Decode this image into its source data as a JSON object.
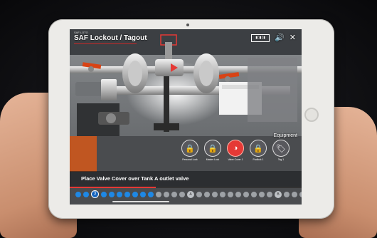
{
  "app": {
    "logo_text": "SAF LOTO",
    "title": "SAF Lockout / Tagout",
    "instruction": "Place Valve Cover over Tank A outlet valve",
    "equipment_label": "Equipment"
  },
  "hud_icons": [
    {
      "name": "qr-code-icon",
      "glyph": "▮▯▮▯▮"
    },
    {
      "name": "speaker-icon",
      "glyph": "🔊"
    },
    {
      "name": "close-icon",
      "glyph": "✕"
    }
  ],
  "equipment": [
    {
      "label": "Personal Lock",
      "icon": "lock-icon",
      "glyph": "🔒",
      "active": false
    },
    {
      "label": "Master Lock",
      "icon": "lock-icon",
      "glyph": "🔒",
      "active": false
    },
    {
      "label": "Valve Cover 1",
      "icon": "valve-cover-icon",
      "glyph": "◑",
      "active": true
    },
    {
      "label": "Padlock 1",
      "icon": "padlock-icon",
      "glyph": "🔒",
      "active": false
    },
    {
      "label": "Tag 1",
      "icon": "tag-icon",
      "glyph": "🏷",
      "active": false
    }
  ],
  "steps": {
    "completed": 2,
    "current_label": "3",
    "total": 30,
    "markers": [
      {
        "index": 14,
        "label": "A"
      },
      {
        "index": 25,
        "label": "B"
      }
    ]
  },
  "progress": 0.37,
  "colors": {
    "accent": "#e53935",
    "step_done": "#1e88e5",
    "step_todo": "#9ea2a6"
  }
}
